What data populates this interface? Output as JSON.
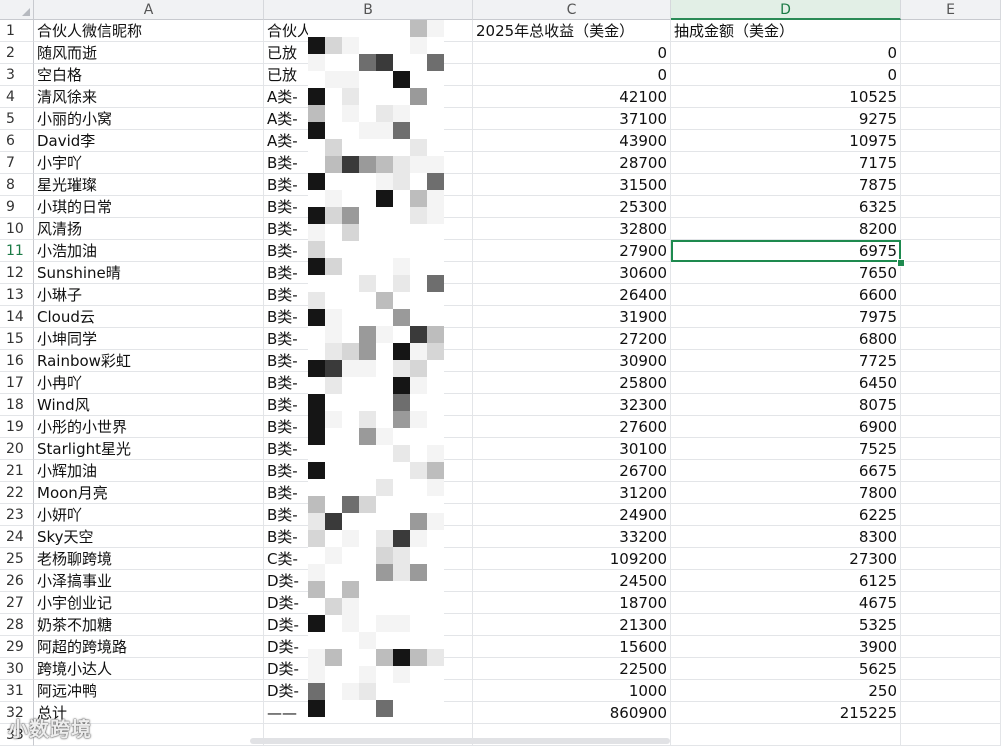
{
  "columns": [
    "A",
    "B",
    "C",
    "D",
    "E"
  ],
  "active_cell": "D11",
  "rows": [
    {
      "n": "1",
      "a": "合伙人微信昵称",
      "b": "合伙人",
      "c": "2025年总收益（美金）",
      "d": "抽成金额（美金）",
      "header": true
    },
    {
      "n": "2",
      "a": "随风而逝",
      "b": "已放",
      "c": "0",
      "d": "0"
    },
    {
      "n": "3",
      "a": "空白格",
      "b": "已放",
      "c": "0",
      "d": "0"
    },
    {
      "n": "4",
      "a": "清风徐来",
      "b": "A类-",
      "c": "42100",
      "d": "10525"
    },
    {
      "n": "5",
      "a": "小丽的小窝",
      "b": "A类-",
      "c": "37100",
      "d": "9275"
    },
    {
      "n": "6",
      "a": "David李",
      "b": "A类-",
      "c": "43900",
      "d": "10975"
    },
    {
      "n": "7",
      "a": "小宇吖",
      "b": "B类-",
      "c": "28700",
      "d": "7175"
    },
    {
      "n": "8",
      "a": "星光璀璨",
      "b": "B类-",
      "c": "31500",
      "d": "7875"
    },
    {
      "n": "9",
      "a": "小琪的日常",
      "b": "B类-",
      "c": "25300",
      "d": "6325"
    },
    {
      "n": "10",
      "a": "风清扬",
      "b": "B类-",
      "c": "32800",
      "d": "8200"
    },
    {
      "n": "11",
      "a": "小浩加油",
      "b": "B类-",
      "c": "27900",
      "d": "6975"
    },
    {
      "n": "12",
      "a": "Sunshine晴",
      "b": "B类-",
      "c": "30600",
      "d": "7650"
    },
    {
      "n": "13",
      "a": "小琳子",
      "b": "B类-",
      "c": "26400",
      "d": "6600"
    },
    {
      "n": "14",
      "a": "Cloud云",
      "b": "B类-",
      "c": "31900",
      "d": "7975"
    },
    {
      "n": "15",
      "a": "小坤同学",
      "b": "B类-",
      "c": "27200",
      "d": "6800"
    },
    {
      "n": "16",
      "a": "Rainbow彩虹",
      "b": "B类-",
      "c": "30900",
      "d": "7725"
    },
    {
      "n": "17",
      "a": "小冉吖",
      "b": "B类-",
      "c": "25800",
      "d": "6450"
    },
    {
      "n": "18",
      "a": "Wind风",
      "b": "B类-",
      "c": "32300",
      "d": "8075"
    },
    {
      "n": "19",
      "a": "小彤的小世界",
      "b": "B类-",
      "c": "27600",
      "d": "6900"
    },
    {
      "n": "20",
      "a": "Starlight星光",
      "b": "B类-",
      "c": "30100",
      "d": "7525"
    },
    {
      "n": "21",
      "a": "小辉加油",
      "b": "B类-",
      "c": "26700",
      "d": "6675"
    },
    {
      "n": "22",
      "a": "Moon月亮",
      "b": "B类-",
      "c": "31200",
      "d": "7800"
    },
    {
      "n": "23",
      "a": "小妍吖",
      "b": "B类-",
      "c": "24900",
      "d": "6225"
    },
    {
      "n": "24",
      "a": "Sky天空",
      "b": "B类-",
      "c": "33200",
      "d": "8300"
    },
    {
      "n": "25",
      "a": "老杨聊跨境",
      "b": "C类-",
      "c": "109200",
      "d": "27300"
    },
    {
      "n": "26",
      "a": "小泽搞事业",
      "b": "D类-",
      "c": "24500",
      "d": "6125"
    },
    {
      "n": "27",
      "a": "小宇创业记",
      "b": "D类-",
      "c": "18700",
      "d": "4675"
    },
    {
      "n": "28",
      "a": "奶茶不加糖",
      "b": "D类-",
      "c": "21300",
      "d": "5325"
    },
    {
      "n": "29",
      "a": "阿超的跨境路",
      "b": "D类-",
      "c": "15600",
      "d": "3900"
    },
    {
      "n": "30",
      "a": "跨境小达人",
      "b": "D类-",
      "c": "22500",
      "d": "5625"
    },
    {
      "n": "31",
      "a": "阿远冲鸭",
      "b": "D类-",
      "c": "1000",
      "d": "250"
    },
    {
      "n": "32",
      "a": "总计",
      "b": "——",
      "c": "860900",
      "d": "215225"
    },
    {
      "n": "33",
      "a": "",
      "b": "",
      "c": "",
      "d": ""
    }
  ],
  "watermark": "小数跨境",
  "colors": {
    "accent": "#1e8a4f",
    "header_bg": "#f1f2f4",
    "grid": "#e3e5e8"
  }
}
